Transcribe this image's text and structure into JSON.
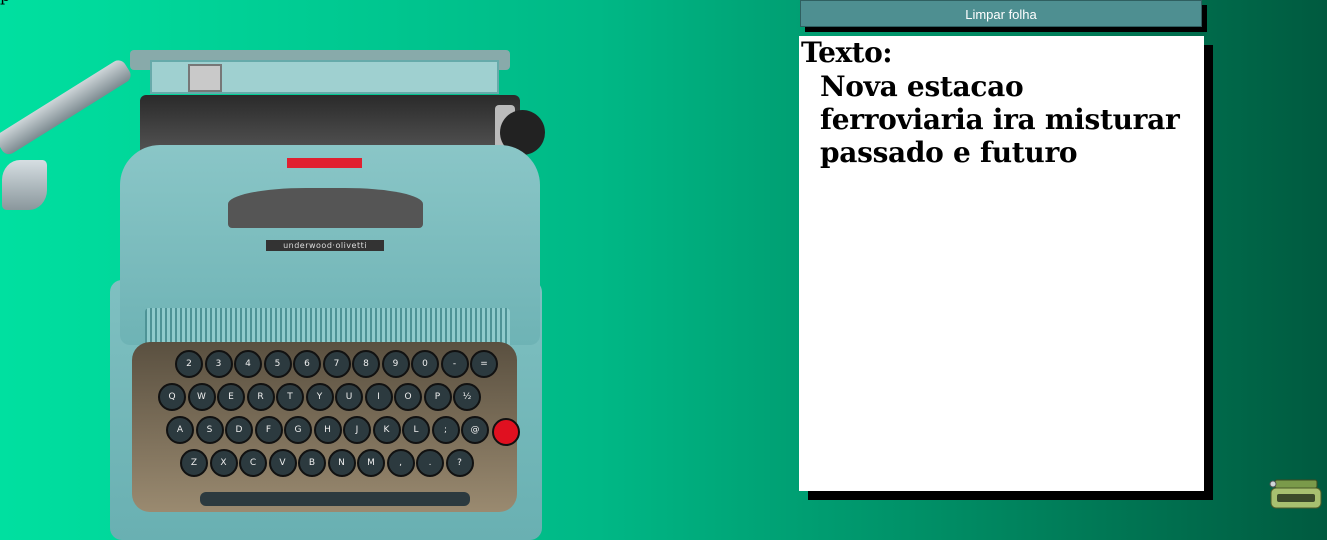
{
  "header": {
    "corner_text": "p"
  },
  "typewriter": {
    "brand": "underwood·olivetti",
    "keys_row1": [
      "2",
      "3",
      "4",
      "5",
      "6",
      "7",
      "8",
      "9",
      "0",
      "-",
      "="
    ],
    "keys_row2": [
      "Q",
      "W",
      "E",
      "R",
      "T",
      "Y",
      "U",
      "I",
      "O",
      "P",
      "½"
    ],
    "keys_row3": [
      "A",
      "S",
      "D",
      "F",
      "G",
      "H",
      "J",
      "K",
      "L",
      ";",
      "@"
    ],
    "keys_row4": [
      "Z",
      "X",
      "C",
      "V",
      "B",
      "N",
      "M",
      ",",
      ".",
      "?"
    ]
  },
  "toolbar": {
    "clear_label": "Limpar folha"
  },
  "paper": {
    "label": "Texto:",
    "text": "Nova estacao ferroviaria ira misturar passado e futuro"
  },
  "colors": {
    "panel_button": "#4e8f91",
    "background_left": "#00e0a0",
    "background_right": "#005a3f"
  }
}
